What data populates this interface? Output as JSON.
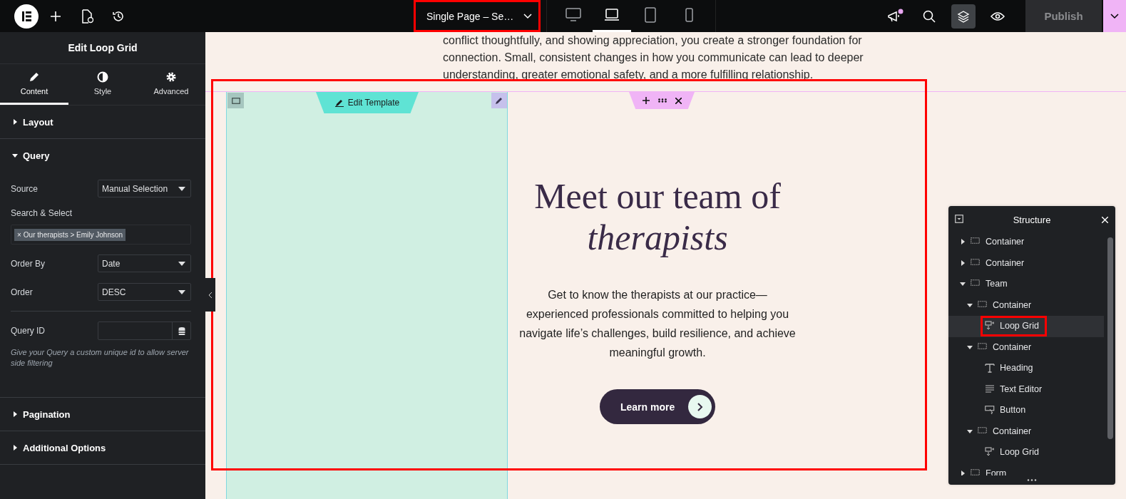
{
  "topbar": {
    "title": {
      "text": "Single Page – Se…",
      "highlighted": true
    },
    "devices": [
      {
        "kind": "desktop",
        "selected": false
      },
      {
        "kind": "laptop",
        "selected": true
      },
      {
        "kind": "tablet",
        "selected": false
      },
      {
        "kind": "mobile",
        "selected": false
      }
    ],
    "notifications": {
      "unread": true
    },
    "structure_toggle": {
      "active": true
    },
    "publish": {
      "label": "Publish",
      "disabled": true
    }
  },
  "panel": {
    "title": "Edit Loop Grid",
    "tabs": [
      {
        "label": "Content",
        "selected": true
      },
      {
        "label": "Style",
        "selected": false
      },
      {
        "label": "Advanced",
        "selected": false
      }
    ],
    "sections": [
      {
        "title": "Layout",
        "expanded": false
      },
      {
        "title": "Query",
        "expanded": true,
        "controls": [
          {
            "kind": "select",
            "label": "Source",
            "value": "Manual Selection"
          },
          {
            "kind": "tags",
            "label": "Search & Select",
            "tags": [
              {
                "remove": "×",
                "label": "Our therapists > Emily Johnson"
              }
            ]
          },
          {
            "kind": "select",
            "label": "Order By",
            "value": "Date"
          },
          {
            "kind": "select",
            "label": "Order",
            "value": "DESC"
          },
          {
            "kind": "text",
            "label": "Query ID",
            "help": "Give your Query a custom unique id to allow server side filtering"
          }
        ]
      },
      {
        "title": "Pagination",
        "expanded": false
      },
      {
        "title": "Additional Options",
        "expanded": false
      }
    ]
  },
  "canvas": {
    "intro": "conflict thoughtfully, and showing appreciation, you create a stronger foundation for connection. Small, consistent changes in how you communicate can lead to deeper understanding, greater emotional safety, and a more fulfilling relationship.",
    "team_section": {
      "highlighted": true,
      "edit_template": "Edit Template",
      "heading": "Meet our team of *therapists*",
      "text": "Get to know the therapists at our practice—experienced professionals committed to helping you navigate life’s challenges, build resilience, and achieve meaningful growth.",
      "button": "Learn more"
    }
  },
  "structure": {
    "title": "Structure",
    "tree": [
      {
        "kind": "container",
        "label": "Container",
        "expanded": false,
        "selected": false,
        "highlighted": false
      },
      {
        "kind": "container",
        "label": "Container",
        "expanded": false,
        "selected": false,
        "highlighted": false
      },
      {
        "kind": "container",
        "label": "Team",
        "expanded": true,
        "selected": false,
        "highlighted": false,
        "children": [
          {
            "kind": "container",
            "label": "Container",
            "expanded": true,
            "selected": false,
            "highlighted": false,
            "children": [
              {
                "kind": "loop-grid",
                "label": "Loop Grid",
                "selected": true,
                "highlighted": true
              }
            ]
          },
          {
            "kind": "container",
            "label": "Container",
            "expanded": true,
            "selected": false,
            "highlighted": false,
            "children": [
              {
                "kind": "heading",
                "label": "Heading",
                "selected": false,
                "highlighted": false
              },
              {
                "kind": "text-editor",
                "label": "Text Editor",
                "selected": false,
                "highlighted": false
              },
              {
                "kind": "button",
                "label": "Button",
                "selected": false,
                "highlighted": false
              }
            ]
          },
          {
            "kind": "container",
            "label": "Container",
            "expanded": true,
            "selected": false,
            "highlighted": false,
            "children": [
              {
                "kind": "loop-grid",
                "label": "Loop Grid",
                "selected": false,
                "highlighted": false
              }
            ]
          }
        ]
      },
      {
        "kind": "container",
        "label": "Form",
        "expanded": false,
        "selected": false,
        "highlighted": false
      }
    ]
  }
}
